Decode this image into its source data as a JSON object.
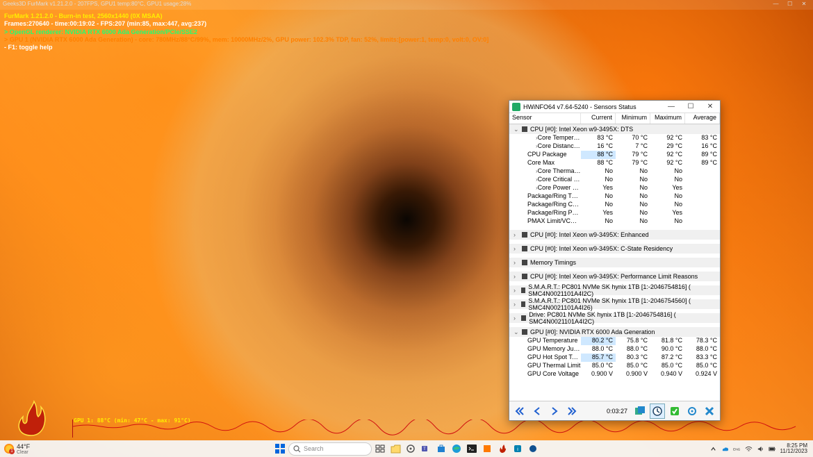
{
  "furmark": {
    "window_title": "Geeks3D FurMark v1.21.2.0 - 207FPS, GPU1 temp:80°C, GPU1 usage:28%",
    "osd_line1": "FurMark 1.21.2.0 - Burn-in test, 2560x1440 (0X MSAA)",
    "osd_line2": "Frames:270640 - time:00:19:02 - FPS:207 (min:85, max:447, avg:237)",
    "osd_line3": "> OpenGL renderer: NVIDIA RTX 6000 Ada Generation/PCIe/SSE2",
    "osd_line4": "> GPU 1 (NVIDIA RTX 6000 Ada Generation) - core: 780MHz/88°C/99%, mem: 10000MHz/2%, GPU power: 102.3% TDP, fan: 52%, limits:[power:1, temp:0, volt:0, OV:0]",
    "osd_line5": "- F1: toggle help",
    "gpu_graph_label": "GPU 1: 88°C (min: 47°C - max: 91°C)"
  },
  "hwinfo": {
    "title": "HWiNFO64 v7.64-5240 - Sensors Status",
    "columns": {
      "sensor": "Sensor",
      "current": "Current",
      "minimum": "Minimum",
      "maximum": "Maximum",
      "average": "Average"
    },
    "elapsed": "0:03:27",
    "groups": {
      "cpu_dts": {
        "label": "CPU [#0]: Intel Xeon w9-3495X: DTS",
        "rows": [
          {
            "name": "Core Temperatures",
            "cur": "83 °C",
            "min": "70 °C",
            "max": "92 °C",
            "avg": "83 °C",
            "exp": "›"
          },
          {
            "name": "Core Distance to ...",
            "cur": "16 °C",
            "min": "7 °C",
            "max": "29 °C",
            "avg": "16 °C",
            "exp": "›"
          },
          {
            "name": "CPU Package",
            "cur": "88 °C",
            "min": "79 °C",
            "max": "92 °C",
            "avg": "89 °C",
            "hot": true
          },
          {
            "name": "Core Max",
            "cur": "88 °C",
            "min": "79 °C",
            "max": "92 °C",
            "avg": "89 °C"
          },
          {
            "name": "Core Thermal Thr...",
            "cur": "No",
            "min": "No",
            "max": "No",
            "avg": "",
            "exp": "›"
          },
          {
            "name": "Core Critical Tem...",
            "cur": "No",
            "min": "No",
            "max": "No",
            "avg": "",
            "exp": "›"
          },
          {
            "name": "Core Power Limit ...",
            "cur": "Yes",
            "min": "No",
            "max": "Yes",
            "avg": "",
            "exp": "›"
          },
          {
            "name": "Package/Ring Therma...",
            "cur": "No",
            "min": "No",
            "max": "No",
            "avg": ""
          },
          {
            "name": "Package/Ring Critica...",
            "cur": "No",
            "min": "No",
            "max": "No",
            "avg": ""
          },
          {
            "name": "Package/Ring Power ...",
            "cur": "Yes",
            "min": "No",
            "max": "Yes",
            "avg": ""
          },
          {
            "name": "PMAX Limit/VCCIN U...",
            "cur": "No",
            "min": "No",
            "max": "No",
            "avg": ""
          }
        ]
      },
      "cpu_enh": {
        "label": "CPU [#0]: Intel Xeon w9-3495X: Enhanced"
      },
      "cpu_cstate": {
        "label": "CPU [#0]: Intel Xeon w9-3495X: C-State Residency"
      },
      "mem": {
        "label": "Memory Timings"
      },
      "cpu_plr": {
        "label": "CPU [#0]: Intel Xeon w9-3495X: Performance Limit Reasons"
      },
      "smart1": {
        "label": "S.M.A.R.T.: PC801 NVMe SK hynix 1TB [1:-2046754816] (   SMC4N0021101A4I2C)"
      },
      "smart2": {
        "label": "S.M.A.R.T.: PC801 NVMe SK hynix 1TB [1:-2046754560] (   SMC4N0021101A4I26)"
      },
      "drive": {
        "label": "Drive: PC801 NVMe SK hynix 1TB [1:-2046754816] (   SMC4N0021101A4I2C)"
      },
      "gpu": {
        "label": "GPU [#0]: NVIDIA RTX 6000 Ada Generation",
        "rows": [
          {
            "name": "GPU Temperature",
            "cur": "80.2 °C",
            "min": "75.8 °C",
            "max": "81.8 °C",
            "avg": "78.3 °C",
            "hot": true
          },
          {
            "name": "GPU Memory Junctio...",
            "cur": "88.0 °C",
            "min": "88.0 °C",
            "max": "90.0 °C",
            "avg": "88.0 °C"
          },
          {
            "name": "GPU Hot Spot Tempe...",
            "cur": "85.7 °C",
            "min": "80.3 °C",
            "max": "87.2 °C",
            "avg": "83.3 °C",
            "hot": true
          },
          {
            "name": "GPU Thermal Limit",
            "cur": "85.0 °C",
            "min": "85.0 °C",
            "max": "85.0 °C",
            "avg": "85.0 °C"
          },
          {
            "name": "GPU Core Voltage",
            "cur": "0.900 V",
            "min": "0.900 V",
            "max": "0.940 V",
            "avg": "0.924 V"
          }
        ]
      }
    }
  },
  "taskbar": {
    "weather_temp": "44°F",
    "weather_cond": "Clear",
    "search_placeholder": "Search",
    "time": "8:25 PM",
    "date": "11/12/2023"
  }
}
